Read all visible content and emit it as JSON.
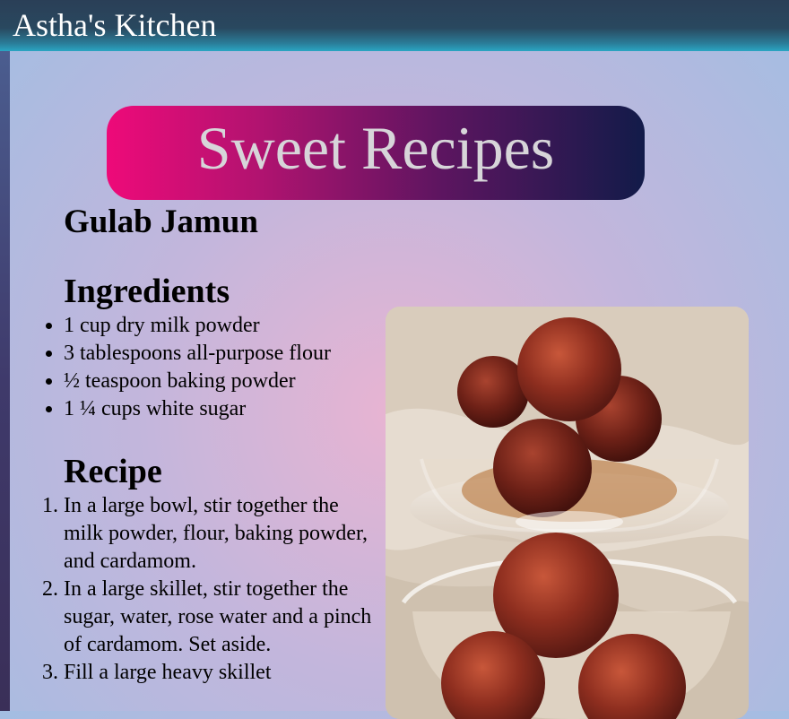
{
  "header": {
    "title": "Astha's Kitchen"
  },
  "banner": {
    "title": "Sweet Recipes"
  },
  "recipe": {
    "name": "Gulab Jamun",
    "ingredients_heading": "Ingredients",
    "ingredients": [
      "1 cup dry milk powder",
      "3 tablespoons all-purpose flour",
      "½ teaspoon baking powder",
      "1 ¼ cups white sugar"
    ],
    "steps_heading": "Recipe",
    "steps": [
      "In a large bowl, stir together the milk powder, flour, baking powder, and cardamom.",
      "In a large skillet, stir together the sugar, water, rose water and a pinch of cardamom. Set aside.",
      "Fill a large heavy skillet"
    ]
  },
  "colors": {
    "banner_start": "#ee0a79",
    "banner_end": "#121b49",
    "topbar": "#2a3f57"
  }
}
